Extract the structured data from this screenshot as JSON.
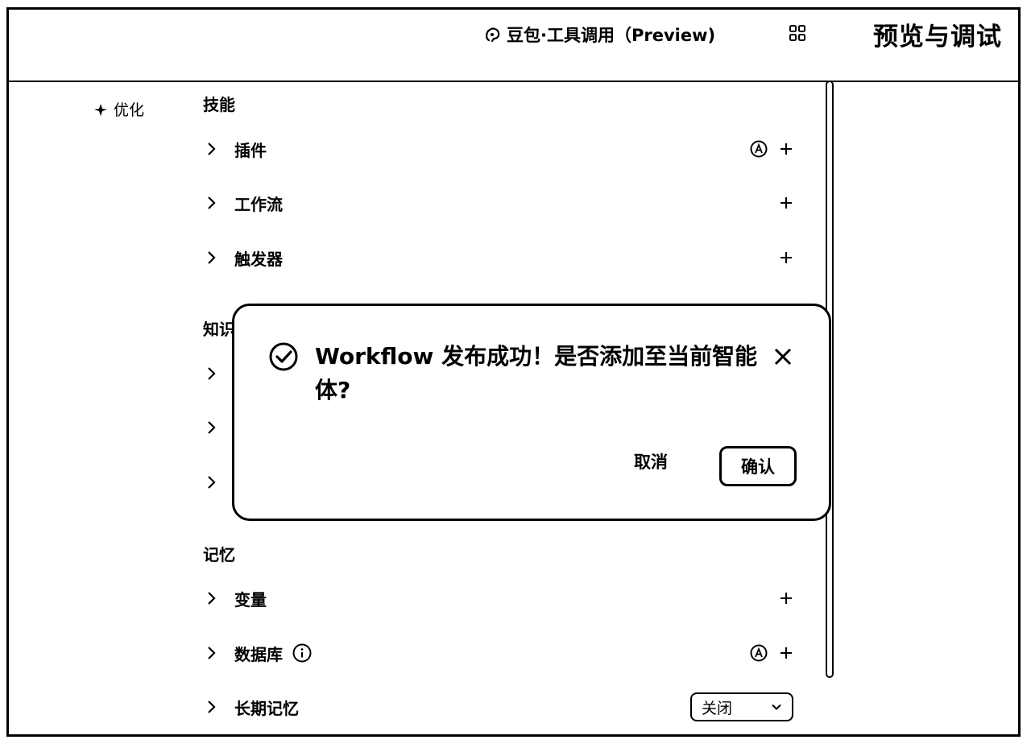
{
  "header": {
    "model_name": "豆包·工具调用（Preview)",
    "preview_title": "预览与调试"
  },
  "sidebar": {
    "optimize_label": "优化"
  },
  "sections": {
    "skills": {
      "title": "技能",
      "items": [
        {
          "label": "插件",
          "auto": true
        },
        {
          "label": "工作流",
          "auto": false
        },
        {
          "label": "触发器",
          "auto": false
        }
      ]
    },
    "knowledge": {
      "title": "知识"
    },
    "memory": {
      "title": "记忆",
      "items": [
        {
          "label": "变量"
        },
        {
          "label": "数据库"
        },
        {
          "label": "长期记忆",
          "select_value": "关闭"
        }
      ]
    }
  },
  "dialog": {
    "message": "Workflow 发布成功！是否添加至当前智能体?",
    "cancel_label": "取消",
    "confirm_label": "确认"
  },
  "icons": {
    "model": "doubao-logo-icon",
    "grid": "grid-icon",
    "optimize": "sparkle-icon",
    "chevron": "chevron-right-icon",
    "add": "plus-icon",
    "auto": "auto-a-icon",
    "info": "info-icon",
    "success": "check-circle-icon",
    "close": "close-icon",
    "dropdown": "chevron-down-icon"
  }
}
